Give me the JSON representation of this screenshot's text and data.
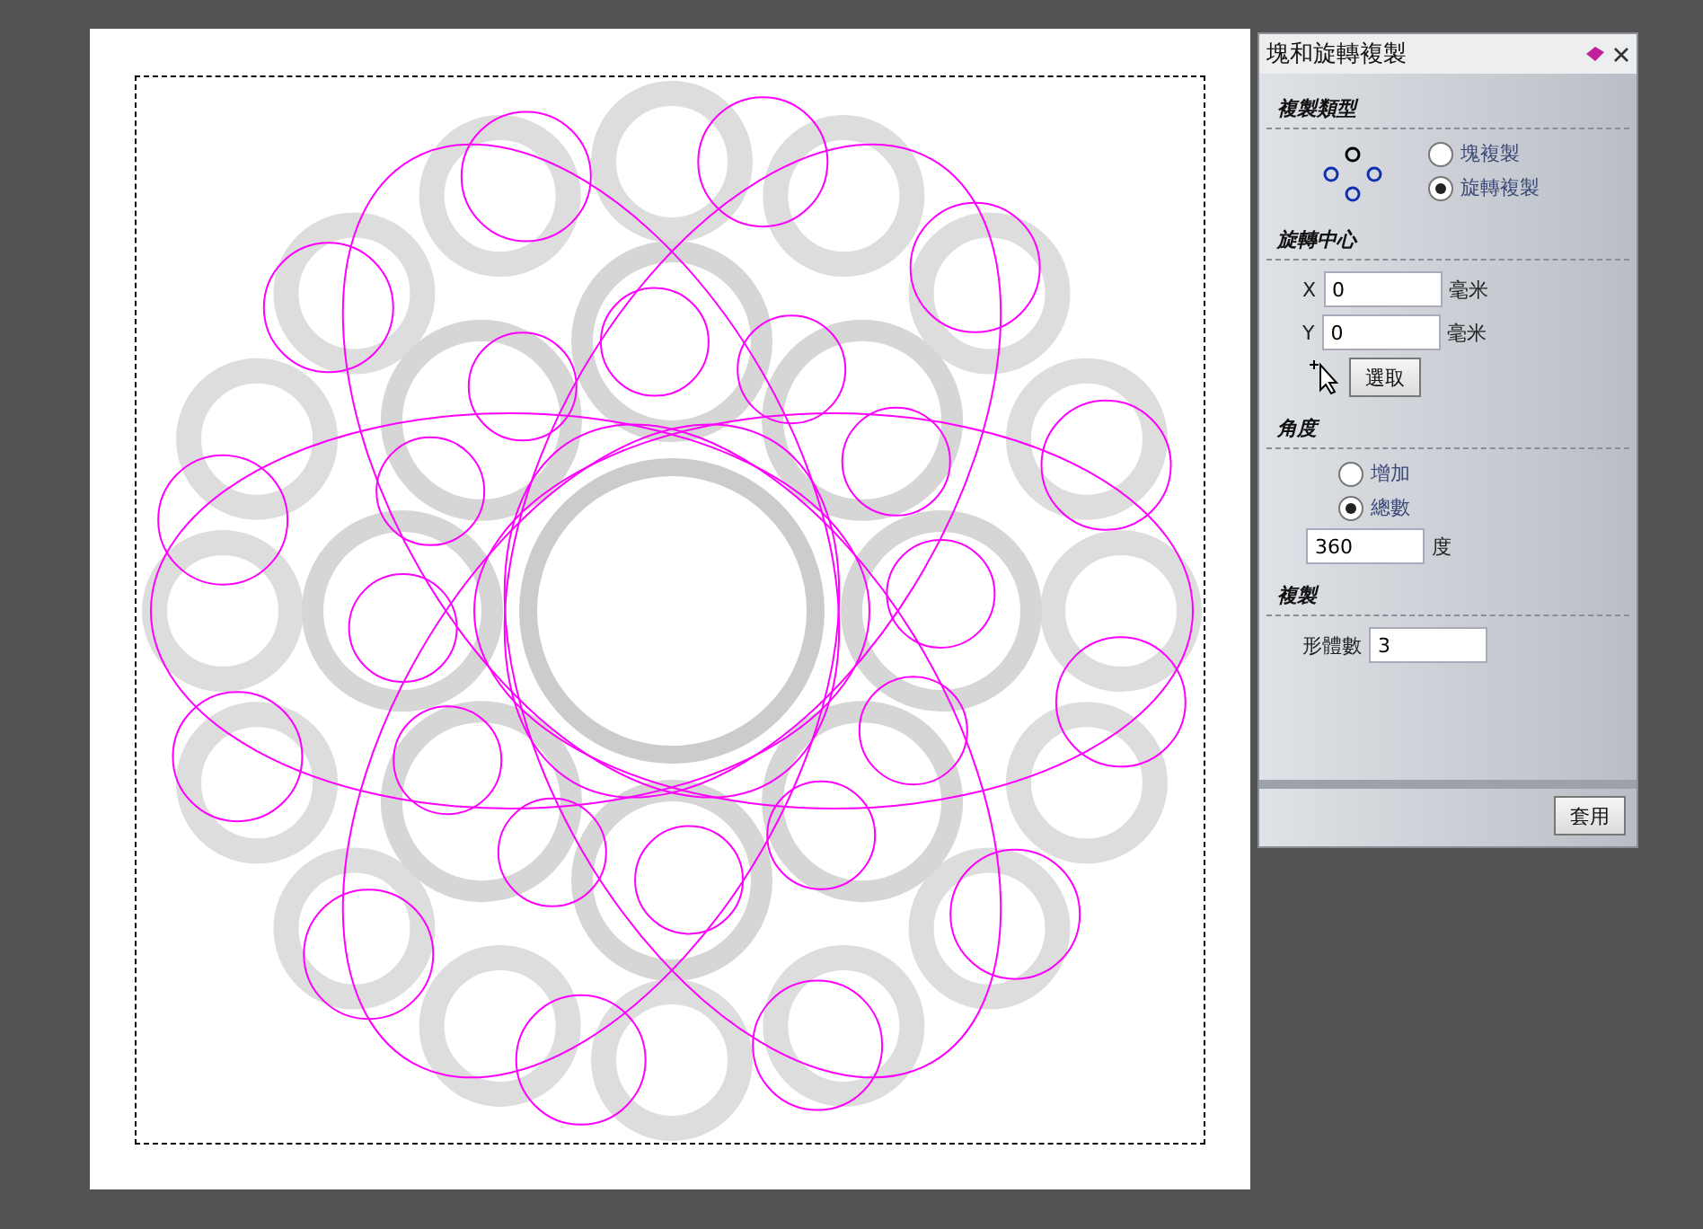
{
  "panel": {
    "title": "塊和旋轉複製"
  },
  "copy_type": {
    "heading": "複製類型",
    "options": [
      {
        "label": "塊複製",
        "selected": false
      },
      {
        "label": "旋轉複製",
        "selected": true
      }
    ]
  },
  "rotation_center": {
    "heading": "旋轉中心",
    "fields": [
      {
        "label": "X",
        "value": "0",
        "unit": "毫米"
      },
      {
        "label": "Y",
        "value": "0",
        "unit": "毫米"
      }
    ],
    "pick_button": "選取"
  },
  "angle": {
    "heading": "角度",
    "options": [
      {
        "label": "增加",
        "selected": false
      },
      {
        "label": "總數",
        "selected": true
      }
    ],
    "value": "360",
    "unit": "度"
  },
  "copies": {
    "heading": "複製",
    "label": "形體數",
    "value": "3"
  },
  "apply_button": "套用"
}
